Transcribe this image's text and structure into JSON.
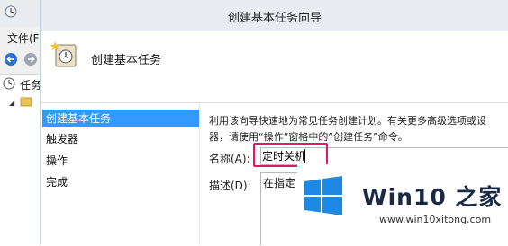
{
  "background_window": {
    "menu_file": "文件(F",
    "tree_root_label": "任务"
  },
  "dialog": {
    "title": "创建基本任务向导",
    "header_title": "创建基本任务",
    "steps": [
      {
        "label": "创建基本任务",
        "active": true
      },
      {
        "label": "触发器",
        "active": false
      },
      {
        "label": "操作",
        "active": false
      },
      {
        "label": "完成",
        "active": false
      }
    ],
    "description_lines": [
      "利用该向导快速地为常见任务创建计划。有关更多高级选项或设",
      "器，请使用“操作”窗格中的“创建任务”命令。"
    ],
    "name_label": "名称(A):",
    "name_value": "定时关机",
    "desc_label": "描述(D):",
    "desc_value": "在指定"
  },
  "watermark": {
    "brand": "Win10 之家",
    "url": "www.win10xitong.com"
  },
  "colors": {
    "selection": "#3399ff",
    "highlight_border": "#e4156e",
    "win_logo": "#1e88e5"
  }
}
